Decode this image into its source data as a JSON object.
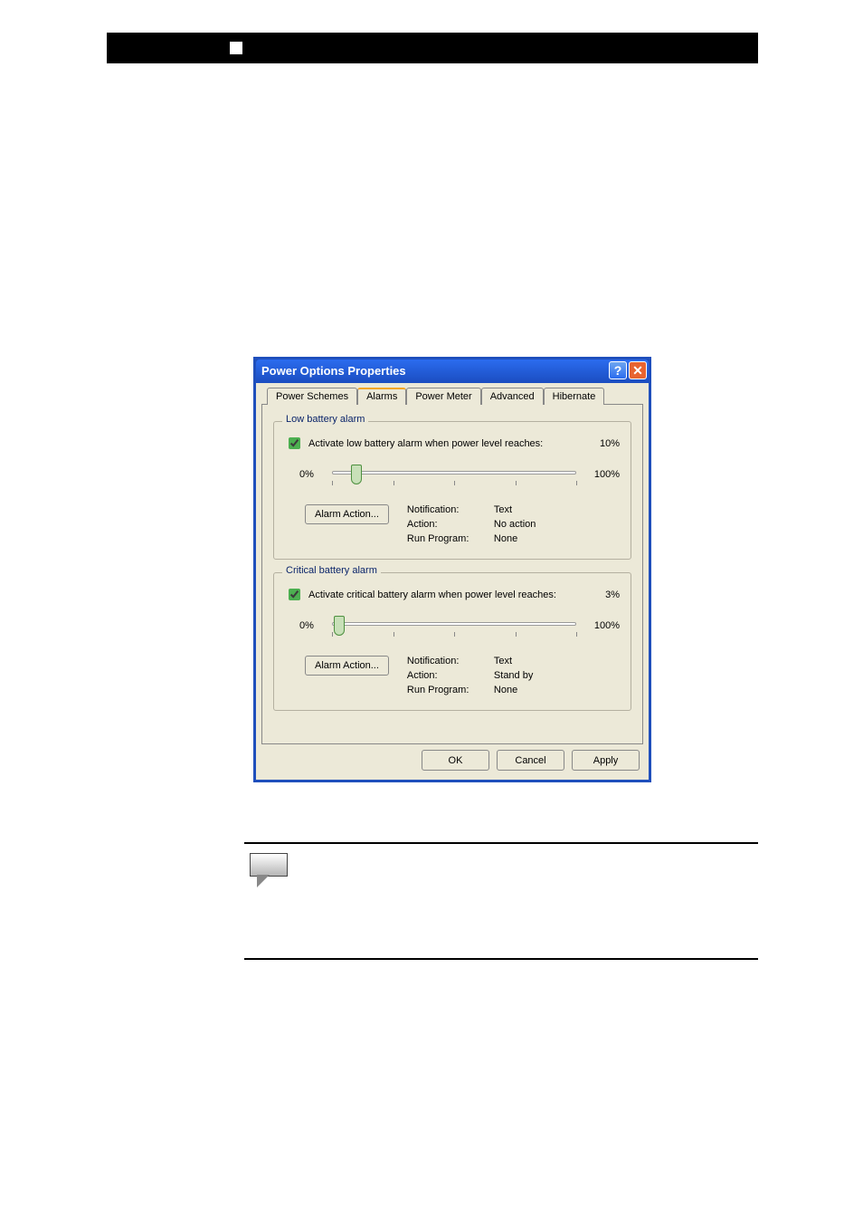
{
  "dialog": {
    "title": "Power Options Properties",
    "tabs": [
      "Power Schemes",
      "Alarms",
      "Power Meter",
      "Advanced",
      "Hibernate"
    ],
    "activeTabIndex": 1,
    "low": {
      "group_title": "Low battery alarm",
      "checkbox_label": "Activate low battery alarm when power level reaches:",
      "value": "10%",
      "min_label": "0%",
      "max_label": "100%",
      "slider_pct": 10,
      "alarm_action_btn": "Alarm Action...",
      "kv": {
        "notification_k": "Notification:",
        "notification_v": "Text",
        "action_k": "Action:",
        "action_v": "No action",
        "run_k": "Run Program:",
        "run_v": "None"
      }
    },
    "critical": {
      "group_title": "Critical battery alarm",
      "checkbox_label": "Activate critical battery alarm when power level reaches:",
      "value": "3%",
      "min_label": "0%",
      "max_label": "100%",
      "slider_pct": 3,
      "alarm_action_btn": "Alarm Action...",
      "kv": {
        "notification_k": "Notification:",
        "notification_v": "Text",
        "action_k": "Action:",
        "action_v": "Stand by",
        "run_k": "Run Program:",
        "run_v": "None"
      }
    },
    "buttons": {
      "ok": "OK",
      "cancel": "Cancel",
      "apply": "Apply"
    }
  }
}
